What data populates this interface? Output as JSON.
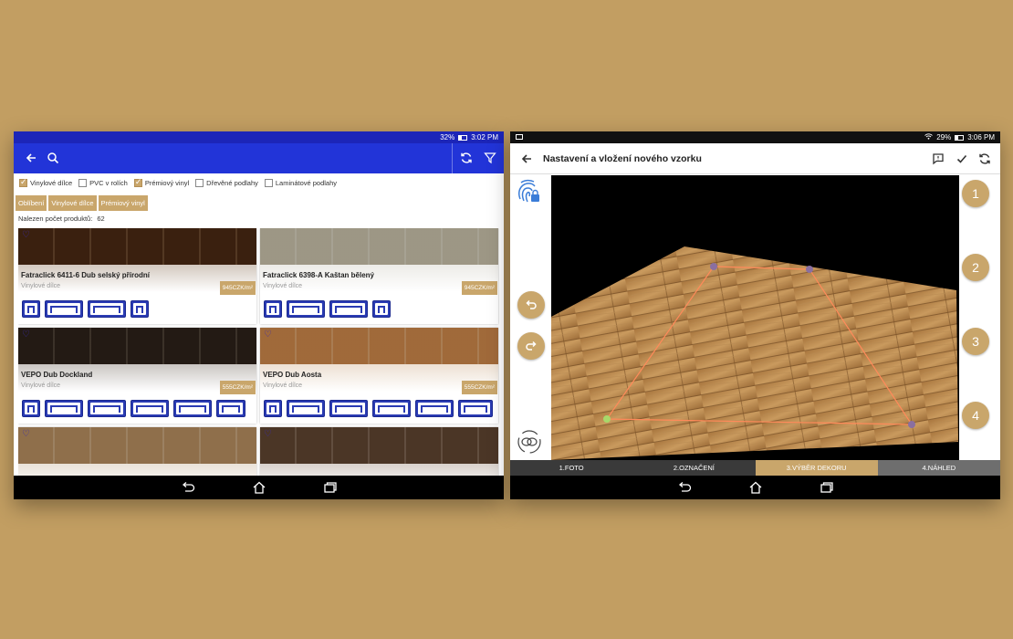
{
  "left_tablet": {
    "status": {
      "battery": "32%",
      "time": "3:02 PM"
    },
    "search": {
      "placeholder": ""
    },
    "filters": [
      {
        "label": "Vinylové dílce",
        "checked": true
      },
      {
        "label": "PVC v rolích",
        "checked": false
      },
      {
        "label": "Prémiový vinyl",
        "checked": true
      },
      {
        "label": "Dřevěné podlahy",
        "checked": false
      },
      {
        "label": "Laminátové podlahy",
        "checked": false
      }
    ],
    "chips": [
      "Oblíbení",
      "Vinylové dílce",
      "Prémiový vinyl"
    ],
    "count": {
      "label": "Nalezen počet produktů:",
      "value": "62"
    },
    "products": [
      {
        "name": "Fatraclick 6411-6 Dub selský přírodní",
        "category": "Vinylové dílce",
        "price": "945CZK/m²",
        "wood_color": "#7a5b3e"
      },
      {
        "name": "Fatraclick 6398-A Kaštan bělený",
        "category": "Vinylové dílce",
        "price": "945CZK/m²",
        "wood_color": "#c8c4b8"
      },
      {
        "name": "VEPO Dub Dockland",
        "category": "Vinylové dílce",
        "price": "555CZK/m²",
        "wood_color": "#5f5247"
      },
      {
        "name": "VEPO Dub Aosta",
        "category": "Vinylové dílce",
        "price": "555CZK/m²",
        "wood_color": "#caa47a"
      },
      {
        "name": "",
        "category": "",
        "price": "",
        "wood_color": "#bfa88a"
      },
      {
        "name": "",
        "category": "",
        "price": "",
        "wood_color": "#8a7563"
      }
    ]
  },
  "right_tablet": {
    "status": {
      "battery": "29%",
      "time": "3:06 PM"
    },
    "title": "Nastavení a vložení nového vzorku",
    "step_numbers": [
      "1",
      "2",
      "3",
      "4"
    ],
    "steps": [
      {
        "label": "1.FOTO",
        "active": false
      },
      {
        "label": "2.OZNAČENÍ",
        "active": false
      },
      {
        "label": "3.VÝBĚR DEKORU",
        "active": true
      },
      {
        "label": "4.NÁHLED",
        "active": false
      }
    ]
  },
  "colors": {
    "background": "#c29e62",
    "accent": "#c9a66b",
    "primary_blue": "#2234d8",
    "dark_blue": "#1c25b8"
  }
}
